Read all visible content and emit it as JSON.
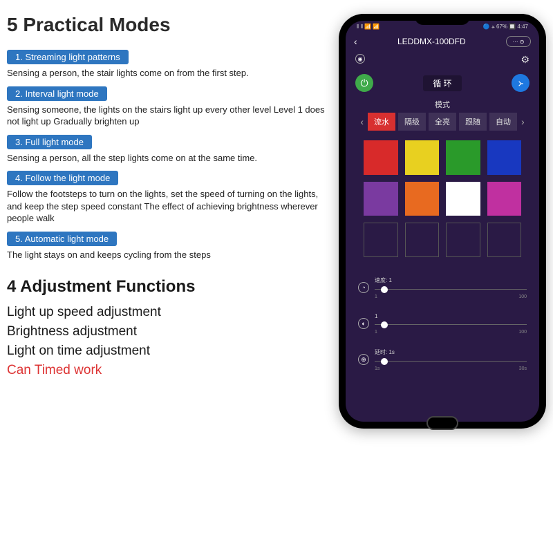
{
  "title": "5 Practical Modes",
  "modes": [
    {
      "label": "1. Streaming light patterns",
      "desc": "Sensing a person, the stair lights come on from the first step."
    },
    {
      "label": "2. Interval light mode",
      "desc": "Sensing someone, the lights on the stairs light up every other level Level 1 does not light up Gradually brighten up"
    },
    {
      "label": "3. Full light mode",
      "desc": "Sensing a person, all the step lights come on at the same time."
    },
    {
      "label": "4. Follow the light mode",
      "desc": "Follow the footsteps to turn on the lights, set the speed of turning on the lights, and keep the step speed constant The effect of achieving brightness wherever people walk"
    },
    {
      "label": "5. Automatic light mode",
      "desc": "The light stays on and keeps cycling from the steps"
    }
  ],
  "subtitle": "4 Adjustment Functions",
  "functions": [
    "Light up speed adjustment",
    "Brightness adjustment",
    "Light on time adjustment"
  ],
  "functions_red": "Can Timed work",
  "phone": {
    "status": {
      "signal": "⫴ ⫴ 📶 📶",
      "battery": "🔵 ⚹ 67% 🔲 4:47"
    },
    "header": {
      "back": "‹",
      "title": "LEDDMX-100DFD",
      "dots": "··· ⊙"
    },
    "center_tag": "循 环",
    "mode_label": "模式",
    "tabs": [
      "流水",
      "隔级",
      "全亮",
      "跟随",
      "自动"
    ],
    "active_tab": 0,
    "arrows": {
      "left": "‹",
      "right": "›"
    },
    "colors": [
      "#d82a2a",
      "#e8d020",
      "#2a9a2a",
      "#1838c0",
      "#7a3aa0",
      "#e86a20",
      "#ffffff",
      "#c030a0"
    ],
    "sliders": [
      {
        "icon": "◔",
        "label": "速度: 1",
        "min": "1",
        "max": "100",
        "pos": 4
      },
      {
        "icon": "◐",
        "label": "1",
        "min": "1",
        "max": "100",
        "pos": 4
      },
      {
        "icon": "⊕",
        "label": "延时: 1s",
        "min": "1s",
        "max": "30s",
        "pos": 4
      }
    ]
  }
}
